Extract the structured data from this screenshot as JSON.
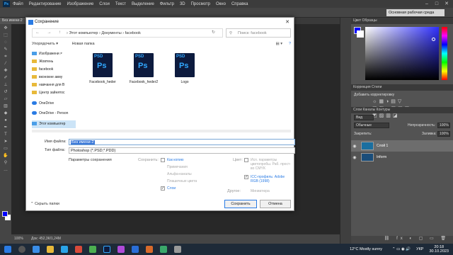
{
  "menubar": {
    "logo": "Ps",
    "items": [
      "Файл",
      "Редактирование",
      "Изображение",
      "Слои",
      "Текст",
      "Выделение",
      "Фильтр",
      "3D",
      "Просмотр",
      "Окно",
      "Справка"
    ]
  },
  "optbar": {
    "workspace": "Основная рабочая среда"
  },
  "doc_tab": {
    "label": "Без имени-2"
  },
  "statusbar": {
    "zoom": "100%",
    "doc": "Док: 452,3К/1,24М"
  },
  "panels": {
    "color_tabs": "Цвет   Образцы",
    "adjust_tabs": "Коррекция   Стили",
    "adjust_add": "Добавить корректировку",
    "layers_tabs": "Слои   Каналы   Контуры",
    "kind": "Вид",
    "blend": "Обычные",
    "opacity_label": "Непрозрачность:",
    "opacity_value": "100%",
    "lock_label": "Закрепить:",
    "fill_label": "Заливка:",
    "fill_value": "100%",
    "layers": [
      "Слой 1",
      "Inform"
    ]
  },
  "dialog": {
    "title": "Сохранение",
    "breadcrumb": "›  Этот компьютер  ›  Документы  ›  facebook",
    "search_placeholder": "Поиск: facebook",
    "organize": "Упорядочить ▾",
    "new_folder": "Новая папка",
    "sidebar": [
      {
        "label": "Изображени ≠",
        "type": "pic"
      },
      {
        "label": "Жовтень",
        "type": "folder"
      },
      {
        "label": "facebook",
        "type": "folder"
      },
      {
        "label": "вконокне акму",
        "type": "folder"
      },
      {
        "label": "навчання для В",
        "type": "folder"
      },
      {
        "label": "Центр зайнятос",
        "type": "folder"
      },
      {
        "label": "OneDrive",
        "type": "cloud"
      },
      {
        "label": "OneDrive - Person",
        "type": "cloud"
      },
      {
        "label": "Этот компьютер",
        "type": "pc"
      }
    ],
    "files": [
      {
        "badge": "PSD",
        "name": "Facebook_heder"
      },
      {
        "badge": "PSD",
        "name": "Facebook_heder2"
      },
      {
        "badge": "PSD",
        "name": "Logo"
      }
    ],
    "filename_label": "Имя файла:",
    "filename_value": "Без имени-2",
    "filetype_label": "Тип файла:",
    "filetype_value": "Photoshop (*.PSD;*.PDD)",
    "save_params": "Параметры сохранения",
    "save_label": "Сохранить:",
    "opt_copy": "Как копию",
    "opt_notes": "Примечания",
    "opt_alpha": "Альфа-каналы",
    "opt_spot": "Плашечные цвета",
    "opt_layers": "Слои",
    "color_label": "Цвет:",
    "color_use": "Исп. параметры цветопробы. Раб. прост-во CMYK",
    "icc": "ICC-профиль: Adobe RGB (1998)",
    "other_label": "Другое:",
    "thumb": "Миниатюра",
    "hide_folders": "Скрыть папки",
    "save_button": "Сохранить",
    "cancel_button": "Отмена"
  },
  "taskbar": {
    "weather": "12°C  Mostly sunny",
    "lang": "УКР",
    "time": "20:18",
    "date": "30.10.2023"
  }
}
